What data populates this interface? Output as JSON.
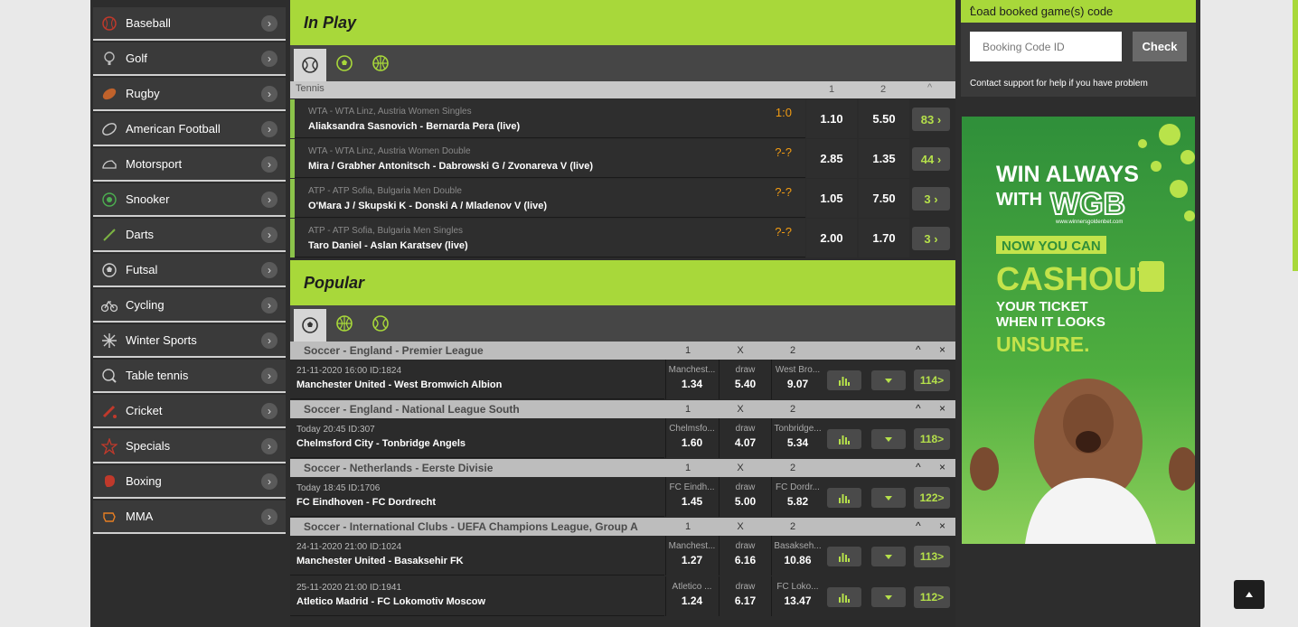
{
  "sidebar": {
    "items": [
      {
        "label": "Baseball",
        "icon": "baseball-icon"
      },
      {
        "label": "Golf",
        "icon": "golf-icon"
      },
      {
        "label": "Rugby",
        "icon": "rugby-icon"
      },
      {
        "label": "American Football",
        "icon": "american-football-icon"
      },
      {
        "label": "Motorsport",
        "icon": "motorsport-icon"
      },
      {
        "label": "Snooker",
        "icon": "snooker-icon"
      },
      {
        "label": "Darts",
        "icon": "darts-icon"
      },
      {
        "label": "Futsal",
        "icon": "futsal-icon"
      },
      {
        "label": "Cycling",
        "icon": "cycling-icon"
      },
      {
        "label": "Winter Sports",
        "icon": "winter-sports-icon"
      },
      {
        "label": "Table tennis",
        "icon": "table-tennis-icon"
      },
      {
        "label": "Cricket",
        "icon": "cricket-icon"
      },
      {
        "label": "Specials",
        "icon": "specials-icon"
      },
      {
        "label": "Boxing",
        "icon": "boxing-icon"
      },
      {
        "label": "MMA",
        "icon": "mma-icon"
      }
    ],
    "arrow": "›"
  },
  "inplay": {
    "title": "In Play",
    "sport": "Tennis",
    "col1": "1",
    "col2": "2",
    "caret": "^",
    "rows": [
      {
        "league": "WTA - WTA Linz, Austria Women Singles",
        "teams": "Aliaksandra Sasnovich - Bernarda Pera (live)",
        "score": "1:0",
        "odd1": "1.10",
        "odd2": "5.50",
        "more": "83 ›"
      },
      {
        "league": "WTA - WTA Linz, Austria Women Double",
        "teams": "Mira / Grabher Antonitsch - Dabrowski G / Zvonareva V (live)",
        "score": "?-?",
        "odd1": "2.85",
        "odd2": "1.35",
        "more": "44 ›"
      },
      {
        "league": "ATP - ATP Sofia, Bulgaria Men Double",
        "teams": "O'Mara J / Skupski K - Donski A / Mladenov V (live)",
        "score": "?-?",
        "odd1": "1.05",
        "odd2": "7.50",
        "more": "3 ›"
      },
      {
        "league": "ATP - ATP Sofia, Bulgaria Men Singles",
        "teams": "Taro Daniel - Aslan Karatsev (live)",
        "score": "?-?",
        "odd1": "2.00",
        "odd2": "1.70",
        "more": "3 ›"
      }
    ]
  },
  "popular": {
    "title": "Popular",
    "groups": [
      {
        "league": "Soccer - England - Premier League",
        "h1": "1",
        "hx": "X",
        "h2": "2",
        "up": "^",
        "close": "×",
        "matches": [
          {
            "date": "21-11-2020 16:00 ID:1824",
            "teams": "Manchester United - West Bromwich Albion",
            "l1": "Manchest...",
            "o1": "1.34",
            "lx": "draw",
            "ox": "5.40",
            "l2": "West Bro...",
            "o2": "9.07",
            "more": "114>"
          }
        ]
      },
      {
        "league": "Soccer - England - National League South",
        "h1": "1",
        "hx": "X",
        "h2": "2",
        "up": "^",
        "close": "×",
        "matches": [
          {
            "date": "Today 20:45 ID:307",
            "teams": "Chelmsford City - Tonbridge Angels",
            "l1": "Chelmsfo...",
            "o1": "1.60",
            "lx": "draw",
            "ox": "4.07",
            "l2": "Tonbridge...",
            "o2": "5.34",
            "more": "118>"
          }
        ]
      },
      {
        "league": "Soccer - Netherlands - Eerste Divisie",
        "h1": "1",
        "hx": "X",
        "h2": "2",
        "up": "^",
        "close": "×",
        "matches": [
          {
            "date": "Today 18:45 ID:1706",
            "teams": "FC Eindhoven - FC Dordrecht",
            "l1": "FC Eindh...",
            "o1": "1.45",
            "lx": "draw",
            "ox": "5.00",
            "l2": "FC Dordr...",
            "o2": "5.82",
            "more": "122>"
          }
        ]
      },
      {
        "league": "Soccer - International Clubs - UEFA Champions League, Group A",
        "h1": "1",
        "hx": "X",
        "h2": "2",
        "up": "^",
        "close": "×",
        "matches": [
          {
            "date": "24-11-2020 21:00 ID:1024",
            "teams": "Manchester United - Basaksehir FK",
            "l1": "Manchest...",
            "o1": "1.27",
            "lx": "draw",
            "ox": "6.16",
            "l2": "Basakseh...",
            "o2": "10.86",
            "more": "113>"
          },
          {
            "date": "25-11-2020 21:00 ID:1941",
            "teams": "Atletico Madrid - FC Lokomotiv Moscow",
            "l1": "Atletico ...",
            "o1": "1.24",
            "lx": "draw",
            "ox": "6.17",
            "l2": "FC Loko...",
            "o2": "13.47",
            "more": "112>"
          }
        ]
      }
    ]
  },
  "booking": {
    "title": "Load booked game(s) code",
    "chevron": "^",
    "placeholder": "Booking Code ID",
    "check": "Check",
    "help": "Contact support for help if you have problem"
  },
  "banner": {
    "line1": "WIN ALWAYS",
    "line2": "WITH",
    "brand": "WGB",
    "url": "www.winnersgoldenbet.com",
    "line3": "NOW YOU CAN",
    "line4": "CASHOUT",
    "line5": "YOUR TICKET",
    "line6": "WHEN IT LOOKS",
    "line7": "UNSURE."
  },
  "colors": {
    "accent": "#a8d83a",
    "odd_more": "#b5e04a",
    "score": "#f39c12",
    "live_bar": "#8bc34a"
  }
}
